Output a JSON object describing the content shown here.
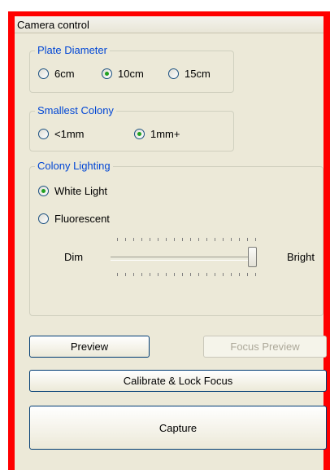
{
  "panel": {
    "title": "Camera control"
  },
  "plate_diameter": {
    "legend": "Plate Diameter",
    "options": [
      {
        "label": "6cm",
        "selected": false
      },
      {
        "label": "10cm",
        "selected": true
      },
      {
        "label": "15cm",
        "selected": false
      }
    ]
  },
  "smallest_colony": {
    "legend": "Smallest Colony",
    "options": [
      {
        "label": "<1mm",
        "selected": false
      },
      {
        "label": "1mm+",
        "selected": true
      }
    ]
  },
  "colony_lighting": {
    "legend": "Colony Lighting",
    "options": [
      {
        "label": "White Light",
        "selected": true
      },
      {
        "label": "Fluorescent",
        "selected": false
      }
    ],
    "slider": {
      "min_label": "Dim",
      "max_label": "Bright",
      "value_fraction": 1.0
    }
  },
  "buttons": {
    "preview": "Preview",
    "focus_preview": "Focus Preview",
    "calibrate": "Calibrate & Lock Focus",
    "capture": "Capture"
  },
  "colors": {
    "accent": "#0046d5",
    "frame": "#ff0000",
    "panel_bg": "#ece9d8"
  }
}
